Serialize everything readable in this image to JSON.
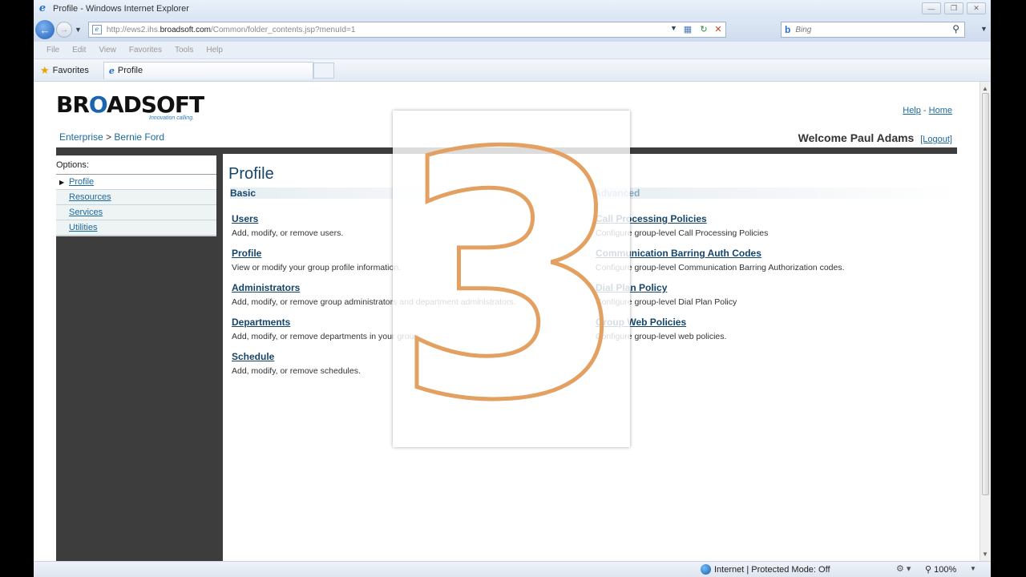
{
  "window": {
    "title": "Profile - Windows Internet Explorer",
    "url_prefix": "http://ews2.ihs.",
    "url_domain": "broadsoft.com",
    "url_suffix": "/Common/folder_contents.jsp?menuId=1",
    "search_placeholder": "Bing"
  },
  "menubar": [
    "File",
    "Edit",
    "View",
    "Favorites",
    "Tools",
    "Help"
  ],
  "favorites": {
    "label": "Favorites",
    "tab_label": "Profile"
  },
  "header": {
    "logo": {
      "prefix": "BR",
      "o": "O",
      "suffix": "ADSOFT",
      "tagline": "Innovation calling."
    },
    "breadcrumb": {
      "enterprise": "Enterprise",
      "separator": " > ",
      "group": "Bernie Ford"
    },
    "help": "Help",
    "link_sep": " - ",
    "home": "Home",
    "welcome": "Welcome Paul Adams",
    "logout": "[Logout]"
  },
  "sidebar": {
    "title": "Options:",
    "items": [
      {
        "label": "Profile",
        "active": true
      },
      {
        "label": "Resources"
      },
      {
        "label": "Services"
      },
      {
        "label": "Utilities"
      }
    ]
  },
  "main": {
    "title": "Profile",
    "basic_heading": "Basic",
    "advanced_heading": "Advanced",
    "basic": [
      {
        "label": "Users",
        "desc": "Add, modify, or remove users."
      },
      {
        "label": "Profile",
        "desc": "View or modify your group profile information."
      },
      {
        "label": "Administrators",
        "desc": "Add, modify, or remove group administrators and department administrators."
      },
      {
        "label": "Departments",
        "desc": "Add, modify, or remove departments in your group."
      },
      {
        "label": "Schedule",
        "desc": "Add, modify, or remove schedules."
      }
    ],
    "advanced": [
      {
        "label": "Call Processing Policies",
        "desc": "Configure group-level Call Processing Policies"
      },
      {
        "label": "Communication Barring Auth Codes",
        "desc": "Configure group-level Communication Barring Authorization codes."
      },
      {
        "label": "Dial Plan Policy",
        "desc": "Configure group-level Dial Plan Policy"
      },
      {
        "label": "Group Web Policies",
        "desc": "Configure group-level web policies."
      }
    ]
  },
  "overlay": {
    "digit": "3",
    "color": "#e3a060"
  },
  "statusbar": {
    "zone": "Internet | Protected Mode: Off",
    "zoom": "100%"
  }
}
